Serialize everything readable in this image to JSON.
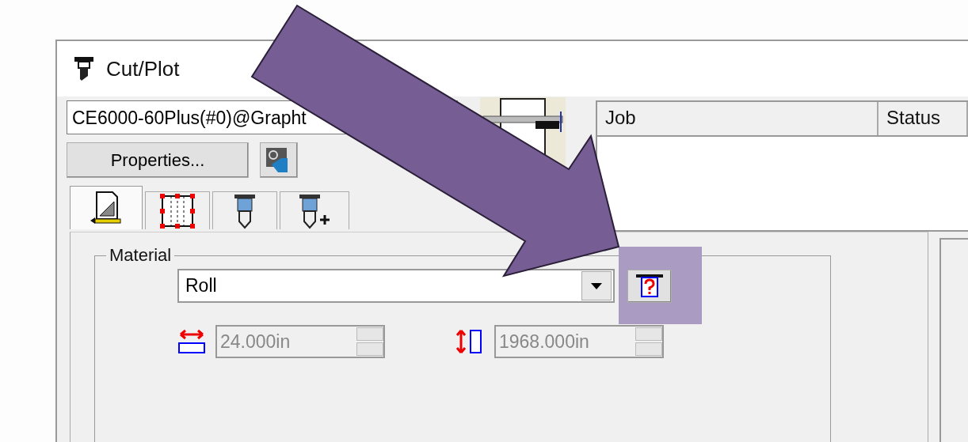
{
  "window": {
    "title": "Cut/Plot"
  },
  "device": {
    "value": "CE6000-60Plus(#0)@Grapht"
  },
  "properties_button": {
    "label": "Properties..."
  },
  "job_list": {
    "columns": [
      "Job",
      "Status"
    ]
  },
  "tabs": [
    {
      "kind": "page",
      "selected": true
    },
    {
      "kind": "area",
      "selected": false
    },
    {
      "kind": "tool",
      "selected": false
    },
    {
      "kind": "tool-add",
      "selected": false
    }
  ],
  "material": {
    "title": "Material",
    "value": "Roll",
    "width": {
      "value": "24.000in",
      "disabled": true
    },
    "length": {
      "value": "1968.000in",
      "disabled": true
    }
  }
}
